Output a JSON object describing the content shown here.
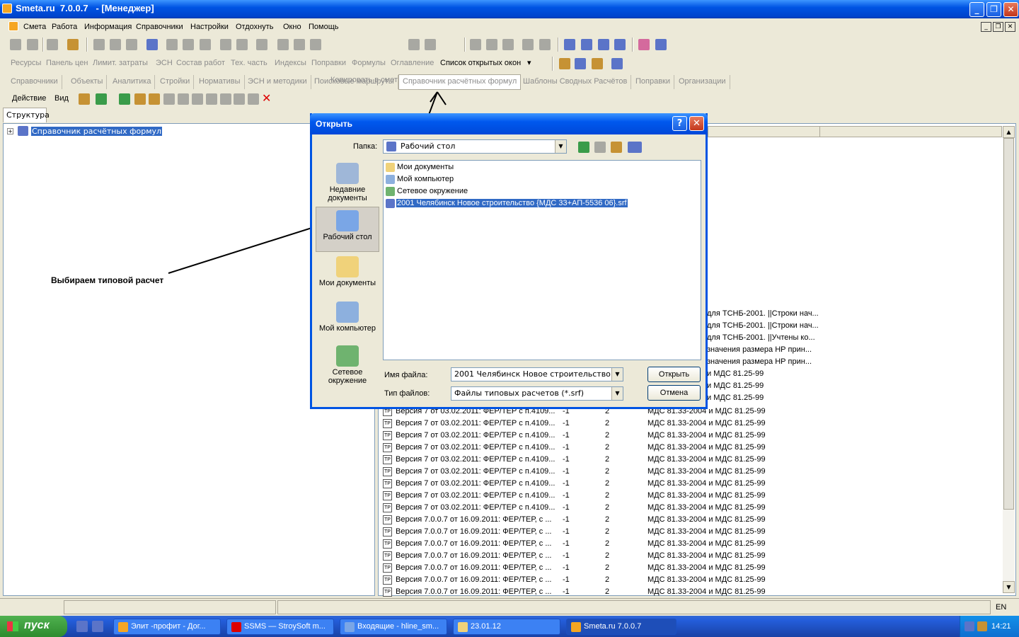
{
  "window": {
    "title": "Smeta.ru  7.0.0.7   - [Менеджер]",
    "minimize": "_",
    "restore": "❐",
    "close": "✕"
  },
  "menu": [
    "Смета",
    "Работа",
    "Информация",
    "Справочники",
    "Настройки",
    "Отдохнуть",
    "Окно",
    "Помощь"
  ],
  "toolbar1": {
    "copy_to_smeta": "Копировать в смету"
  },
  "toolbar2": {
    "items": [
      "Ресурсы",
      "Панель цен",
      "Лимит. затраты",
      "ЭСН",
      "Состав работ",
      "Тех. часть",
      "Индексы",
      "Поправки",
      "Формулы",
      "Оглавление"
    ],
    "open_windows": "Список открытых окон",
    "dropdown_arrow": "▾"
  },
  "tabs": [
    "Справочники",
    "Объекты",
    "Аналитика",
    "Стройки",
    "Нормативы",
    "ЭСН и методики",
    "Поисковые маршруты",
    "Справочник расчётных формул",
    "Шаблоны Сводных Расчётов",
    "Поправки",
    "Организации"
  ],
  "toolbar3": {
    "action": "Действие",
    "view": "Вид"
  },
  "left": {
    "tab": "Структура",
    "tree_expand": "+",
    "tree_root": "Справочник расчётных формул"
  },
  "right": {
    "fragments": [
      "для ТСНБ-2001. ||Строки нач...",
      "для ТСНБ-2001. ||Строки нач...",
      "для ТСНБ-2001. ||Учтены ко...",
      "значения размера НР прин...",
      "значения размера НР прин...",
      "и МДС 81.25-99",
      "и МДС 81.25-99",
      "и МДС 81.25-99"
    ],
    "rows": [
      {
        "icon": "TP",
        "name": "Версия 7 от 03.02.2011: ФЕР/ТЕР с п.4109...",
        "a": "-1",
        "b": "2",
        "c": "МДС 81.33-2004 и МДС 81.25-99"
      },
      {
        "icon": "TP",
        "name": "Версия 7 от 03.02.2011: ФЕР/ТЕР с п.4109...",
        "a": "-1",
        "b": "2",
        "c": "МДС 81.33-2004 и МДС 81.25-99"
      },
      {
        "icon": "TP",
        "name": "Версия 7 от 03.02.2011: ФЕР/ТЕР с п.4109...",
        "a": "-1",
        "b": "2",
        "c": "МДС 81.33-2004 и МДС 81.25-99"
      },
      {
        "icon": "TP",
        "name": "Версия 7 от 03.02.2011: ФЕР/ТЕР с п.4109...",
        "a": "-1",
        "b": "2",
        "c": "МДС 81.33-2004 и МДС 81.25-99"
      },
      {
        "icon": "TP",
        "name": "Версия 7 от 03.02.2011: ФЕР/ТЕР с п.4109...",
        "a": "-1",
        "b": "2",
        "c": "МДС 81.33-2004 и МДС 81.25-99"
      },
      {
        "icon": "TP",
        "name": "Версия 7 от 03.02.2011: ФЕР/ТЕР с п.4109...",
        "a": "-1",
        "b": "2",
        "c": "МДС 81.33-2004 и МДС 81.25-99"
      },
      {
        "icon": "TP",
        "name": "Версия 7 от 03.02.2011: ФЕР/ТЕР с п.4109...",
        "a": "-1",
        "b": "2",
        "c": "МДС 81.33-2004 и МДС 81.25-99"
      },
      {
        "icon": "TP",
        "name": "Версия 7 от 03.02.2011: ФЕР/ТЕР с п.4109...",
        "a": "-1",
        "b": "2",
        "c": "МДС 81.33-2004 и МДС 81.25-99"
      },
      {
        "icon": "TP",
        "name": "Версия 7 от 03.02.2011: ФЕР/ТЕР с п.4109...",
        "a": "-1",
        "b": "2",
        "c": "МДС 81.33-2004 и МДС 81.25-99"
      },
      {
        "icon": "TP",
        "name": "Версия 7.0.0.7 от 16.09.2011: ФЕР/ТЕР, с ...",
        "a": "-1",
        "b": "2",
        "c": "МДС 81.33-2004 и МДС 81.25-99"
      },
      {
        "icon": "TP",
        "name": "Версия 7.0.0.7 от 16.09.2011: ФЕР/ТЕР, с ...",
        "a": "-1",
        "b": "2",
        "c": "МДС 81.33-2004 и МДС 81.25-99"
      },
      {
        "icon": "TP",
        "name": "Версия 7.0.0.7 от 16.09.2011: ФЕР/ТЕР, с ...",
        "a": "-1",
        "b": "2",
        "c": "МДС 81.33-2004 и МДС 81.25-99"
      },
      {
        "icon": "TP",
        "name": "Версия 7.0.0.7 от 16.09.2011: ФЕР/ТЕР, с ...",
        "a": "-1",
        "b": "2",
        "c": "МДС 81.33-2004 и МДС 81.25-99"
      },
      {
        "icon": "TP",
        "name": "Версия 7.0.0.7 от 16.09.2011: ФЕР/ТЕР, с ...",
        "a": "-1",
        "b": "2",
        "c": "МДС 81.33-2004 и МДС 81.25-99"
      },
      {
        "icon": "TP",
        "name": "Версия 7.0.0.7 от 16.09.2011: ФЕР/ТЕР, с ...",
        "a": "-1",
        "b": "2",
        "c": "МДС 81.33-2004 и МДС 81.25-99"
      },
      {
        "icon": "TP",
        "name": "Версия 7.0.0.7 от 16.09.2011: ФЕР/ТЕР, с ...",
        "a": "-1",
        "b": "2",
        "c": "МДС 81.33-2004 и МДС 81.25-99"
      },
      {
        "icon": "TP",
        "name": "Версия 7.0.0.7 от 16.09.2011: ФЕР/ТЕР, с ...",
        "a": "-1",
        "b": "2",
        "c": "МДС 81.33-2004 и МДС 81.25-99"
      }
    ]
  },
  "dialog": {
    "title": "Открыть",
    "help": "?",
    "close": "✕",
    "folder_label": "Папка:",
    "folder_value": "Рабочий стол",
    "places": [
      {
        "line1": "Недавние",
        "line2": "документы"
      },
      {
        "line1": "Рабочий стол",
        "line2": ""
      },
      {
        "line1": "Мои документы",
        "line2": ""
      },
      {
        "line1": "Мой компьютер",
        "line2": ""
      },
      {
        "line1": "Сетевое",
        "line2": "окружение"
      }
    ],
    "files": [
      "Мои документы",
      "Мой компьютер",
      "Сетевое окружение",
      "2001 Челябинск  Новое строительство {МДС 33+АП-5536 06}.srf"
    ],
    "filename_label": "Имя файла:",
    "filename_value": "2001 Челябинск  Новое строительство {МД",
    "filetype_label": "Тип файлов:",
    "filetype_value": "Файлы типовых расчетов (*.srf)",
    "open_button": "Открыть",
    "cancel_button": "Отмена"
  },
  "annotation": "Выбираем типовой расчет",
  "taskbar": {
    "start": "пуск",
    "tasks": [
      "Элит -профит - Дог...",
      "SSMS — StroySoft m...",
      "Входящие - hline_sm...",
      "23.01.12",
      "Smeta.ru  7.0.0.7"
    ],
    "lang": "EN",
    "clock": "14:21"
  }
}
